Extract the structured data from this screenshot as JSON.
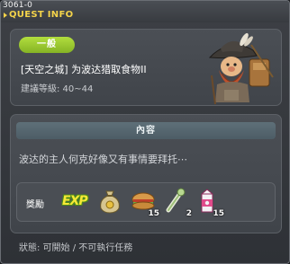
{
  "window": {
    "quest_id": "3061-0",
    "title": "QUEST INFO"
  },
  "quest": {
    "category": "一般",
    "name": "[天空之城] 为波达猎取食物II",
    "level_requirement": "建議等級: 40~44"
  },
  "content": {
    "header": "內容",
    "text": "波达的主人何克好像又有事情要拜托⋯"
  },
  "rewards": {
    "label": "獎勵",
    "items": [
      {
        "name": "exp-icon",
        "count": ""
      },
      {
        "name": "meso-bag-icon",
        "count": ""
      },
      {
        "name": "sandwich-icon",
        "count": "15"
      },
      {
        "name": "bone-icon",
        "count": "2"
      },
      {
        "name": "milk-carton-icon",
        "count": "15"
      }
    ],
    "exp_text": "EXP"
  },
  "status": {
    "text": "狀態: 可開始 / 不可執行任務"
  },
  "colors": {
    "title": "#f3d34a",
    "badge": "#9fcb35",
    "header": "#56676f"
  }
}
